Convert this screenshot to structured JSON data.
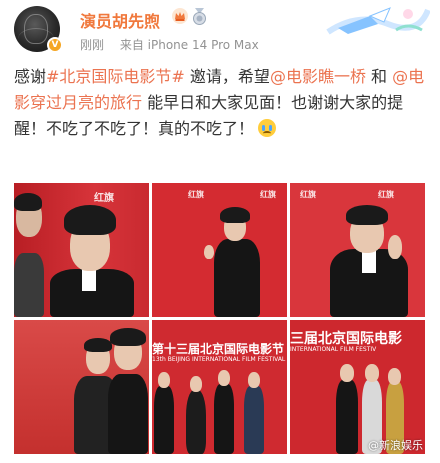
{
  "header": {
    "username": "演员胡先煦",
    "verify_mark": "V",
    "time": "刚刚",
    "source": "来自 iPhone 14 Pro Max"
  },
  "post": {
    "seg1": "感谢",
    "tag1": "#北京国际电影节#",
    "seg2": " 邀请，希望",
    "tag2": "@电影瞧一桥",
    "seg3": " 和 ",
    "tag3": "@电影穿过月亮的旅行",
    "seg4": " 能早日和大家见面！也谢谢大家的提醒！不吃了不吃了！真的不吃了！"
  },
  "photos": {
    "p1_logo": "红旗",
    "p2_logo": "红旗",
    "p3_logo": "红旗",
    "p5_title": "第十三届北京国际电影节",
    "p5_sub": "13th BEIJING INTERNATIONAL FILM FESTIVAL",
    "p6_title": "三届北京国际电影",
    "p6_sub": "INTERNATIONAL FILM FESTIV",
    "watermark": "@新浪娱乐",
    "logo_row": "红旗"
  },
  "colors": {
    "accent": "#eb7350",
    "username": "#f0783c",
    "carpet_red": "#c8242a"
  }
}
